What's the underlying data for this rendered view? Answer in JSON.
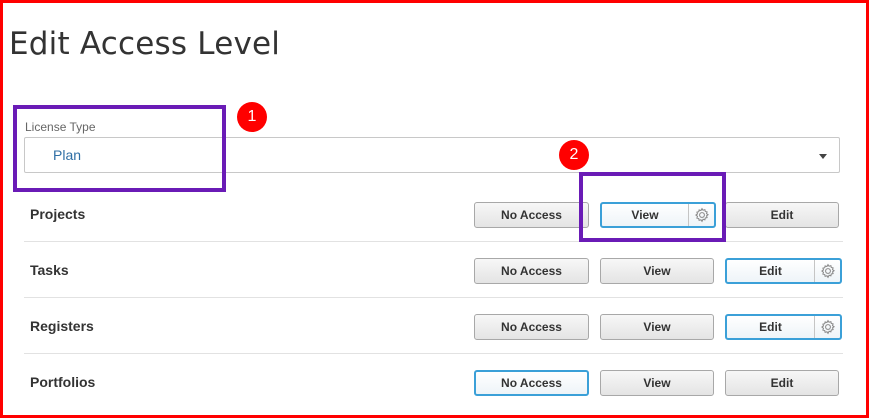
{
  "page": {
    "title": "Edit Access Level"
  },
  "license_type": {
    "label": "License Type",
    "value": "Plan"
  },
  "buttons": {
    "no_access": "No Access",
    "view": "View",
    "edit": "Edit"
  },
  "rows": [
    {
      "label": "Projects",
      "selected": "View",
      "settings_on": "View"
    },
    {
      "label": "Tasks",
      "selected": "Edit",
      "settings_on": "Edit"
    },
    {
      "label": "Registers",
      "selected": "Edit",
      "settings_on": "Edit"
    },
    {
      "label": "Portfolios",
      "selected": "No Access",
      "settings_on": null
    }
  ],
  "annotations": {
    "marker_1": "1",
    "marker_2": "2"
  },
  "colors": {
    "annotation_box": "#6a1bb6",
    "annotation_marker": "#ff0000",
    "selected_border": "#3ba0d8",
    "select_value_text": "#2f6fa5",
    "frame": "#ff0000"
  },
  "icons": {
    "dropdown": "caret-down-icon",
    "settings": "gear-icon"
  }
}
